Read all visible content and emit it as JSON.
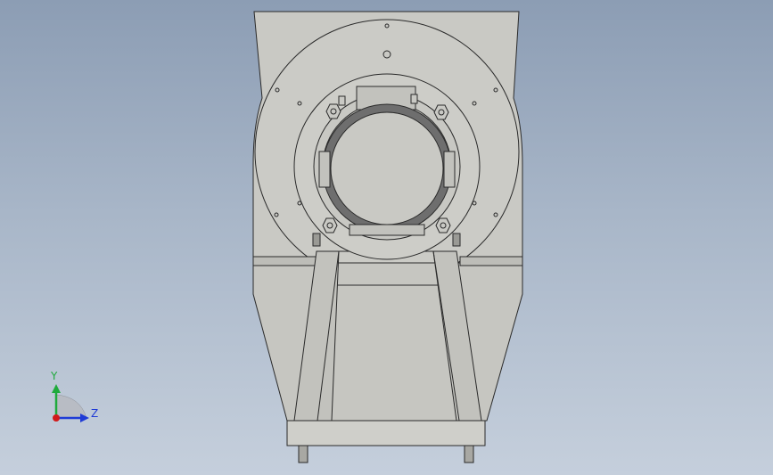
{
  "viewport": {
    "background_top": "#8c9db4",
    "background_bottom": "#c5cfdc"
  },
  "model": {
    "fill_color": "#c9c9c4",
    "shade_color": "#b4b4ae",
    "ring_color": "#6e6e6e",
    "edge_color": "#2a2a2a"
  },
  "triad": {
    "x_label": "Z",
    "y_label": "Y",
    "x_color": "#1f3bd6",
    "y_color": "#1faa3c",
    "origin_color": "#d11a1a"
  }
}
